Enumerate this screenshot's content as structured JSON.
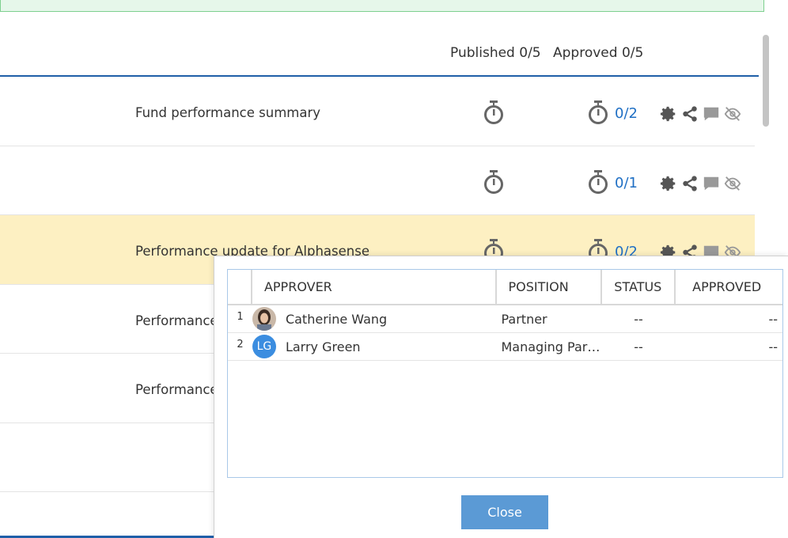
{
  "summary": {
    "published": "Published 0/5",
    "approved": "Approved 0/5"
  },
  "rows": [
    {
      "title": "Fund performance summary",
      "count": "0/2"
    },
    {
      "title": "",
      "count": "0/1"
    },
    {
      "title": "Performance update for Alphasense",
      "count": "0/2"
    },
    {
      "title": "Performance",
      "count": ""
    },
    {
      "title": "Performance",
      "count": ""
    },
    {
      "title": "",
      "count": ""
    }
  ],
  "popup": {
    "columns": {
      "approver": "APPROVER",
      "position": "POSITION",
      "status": "STATUS",
      "approved": "APPROVED"
    },
    "approvers": [
      {
        "index": "1",
        "name": "Catherine Wang",
        "position": "Partner",
        "status": "--",
        "approved": "--"
      },
      {
        "index": "2",
        "initials": "LG",
        "name": "Larry Green",
        "position": "Managing Partner",
        "status": "--",
        "approved": "--"
      }
    ],
    "close_label": "Close"
  },
  "colors": {
    "accent": "#1f6fc4",
    "highlight": "#fdf0c2",
    "button": "#5b9ad5"
  },
  "icons": [
    "timer-icon",
    "gear-icon",
    "share-icon",
    "comment-icon",
    "eye-off-icon"
  ]
}
